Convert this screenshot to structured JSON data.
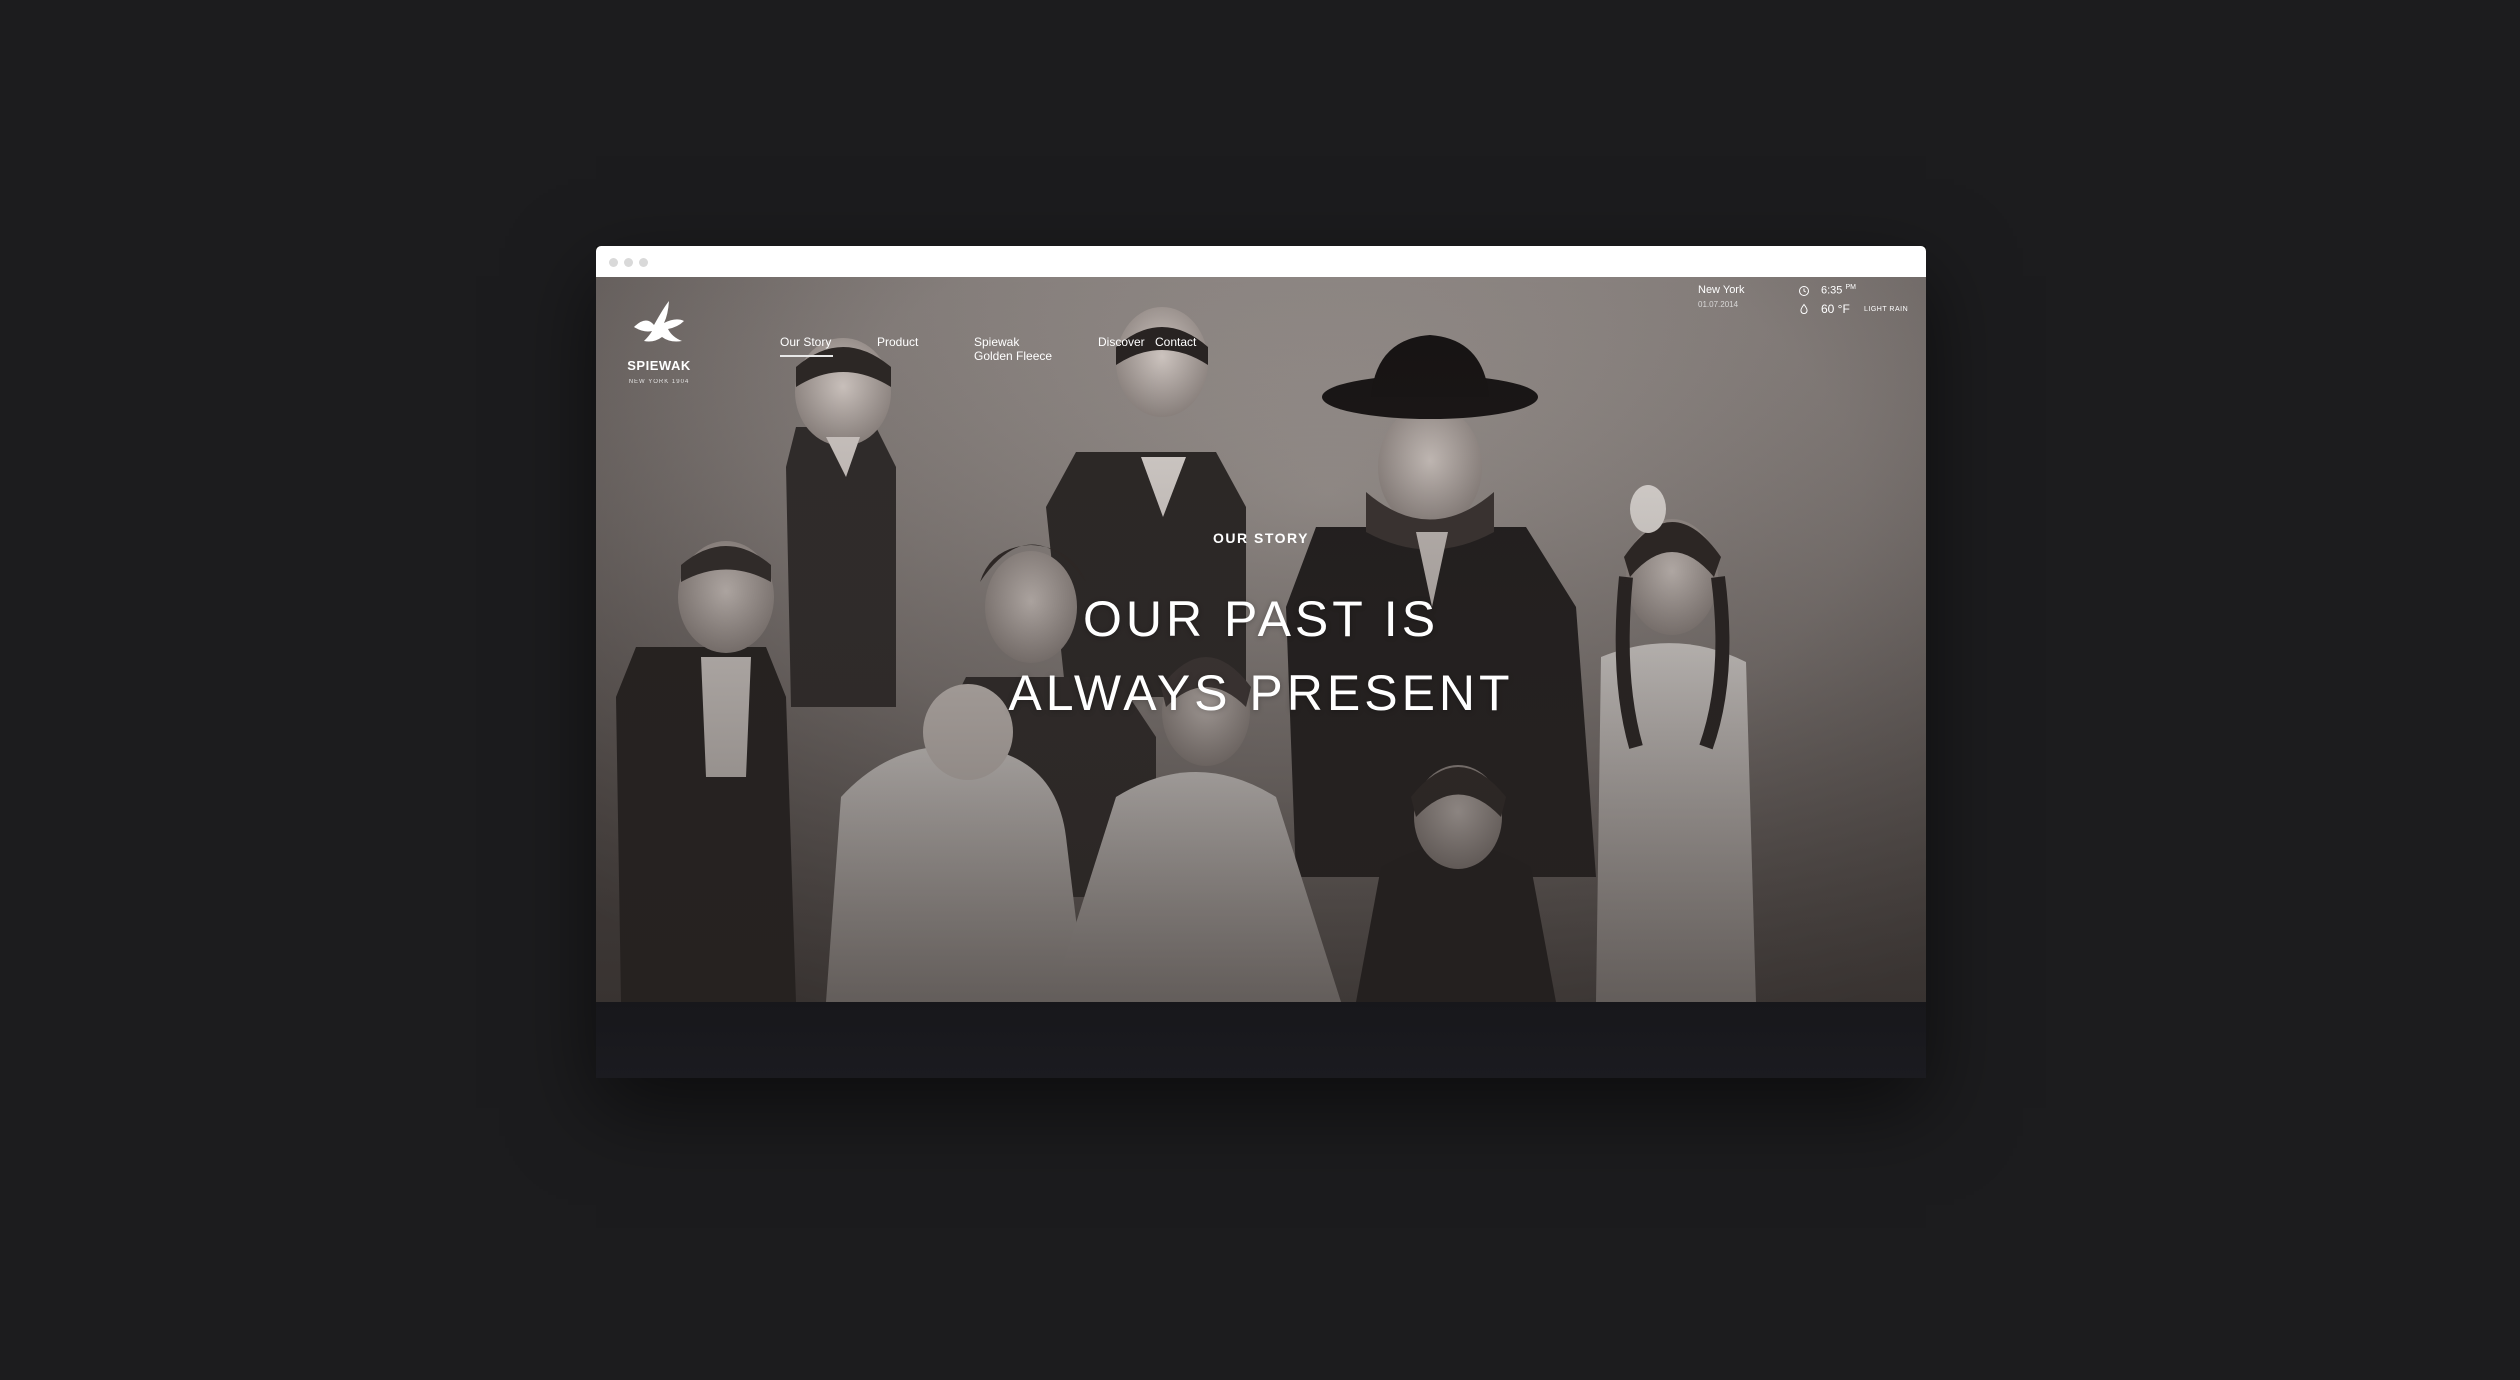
{
  "site": {
    "brand_name": "SPIEWAK",
    "brand_tagline": "NEW YORK 1904",
    "logo_icon": "winged-bird-icon"
  },
  "nav": {
    "items": [
      {
        "label": "Our Story",
        "active": true
      },
      {
        "label": "Product",
        "active": false
      },
      {
        "label": "Spiewak",
        "label2": "Golden Fleece",
        "active": false
      },
      {
        "label": "Discover",
        "active": false
      },
      {
        "label": "Contact",
        "active": false
      }
    ]
  },
  "weather": {
    "city": "New York",
    "date": "01.07.2014",
    "time": "6:35",
    "time_suffix": "PM",
    "temperature": "60 °F",
    "condition": "LIGHT RAIN",
    "clock_icon": "clock-icon",
    "drop_icon": "raindrop-icon"
  },
  "hero": {
    "eyebrow": "OUR STORY",
    "headline_line1": "OUR PAST IS",
    "headline_line2": "ALWAYS PRESENT",
    "image_description_icon": "vintage-family-photo"
  },
  "colors": {
    "page_background": "#1c1c1e",
    "browser_bar": "#ffffff",
    "text": "#ffffff",
    "footer_strip": "#18181c"
  }
}
